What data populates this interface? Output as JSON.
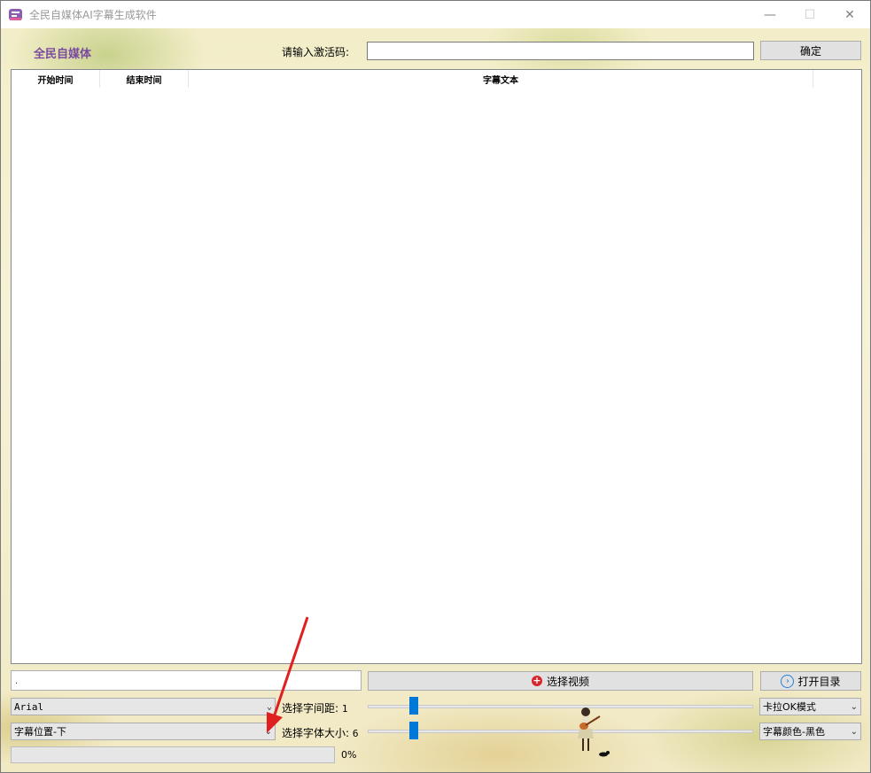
{
  "window": {
    "title": "全民自媒体AI字幕生成软件",
    "minimize_glyph": "—",
    "maximize_glyph": "☐",
    "close_glyph": "✕"
  },
  "header": {
    "brand": "全民自媒体",
    "activation_label": "请输入激活码:",
    "activation_value": "",
    "confirm_label": "确定"
  },
  "table": {
    "columns": [
      "开始时间",
      "结束时间",
      "字幕文本"
    ],
    "rows": []
  },
  "controls": {
    "path_value": ".",
    "select_video_label": "选择视频",
    "open_dir_label": "打开目录",
    "font_select": "Arial",
    "position_select": "字幕位置-下",
    "spacing_label": "选择字间距:",
    "spacing_value": "1",
    "spacing_fraction": 0.11,
    "size_label": "选择字体大小:",
    "size_value": "6",
    "size_fraction": 0.11,
    "mode_select": "卡拉OK模式",
    "color_select": "字幕颜色-黑色",
    "progress_text": "0%",
    "progress_percent": 0
  },
  "icons": {
    "plus": "+",
    "circle_arrow": "›",
    "chevron": "⌄"
  },
  "colors": {
    "brand": "#7a4aa0",
    "slider_thumb": "#0078d7",
    "plus_icon": "#d9262c",
    "arrow": "#e02020"
  }
}
